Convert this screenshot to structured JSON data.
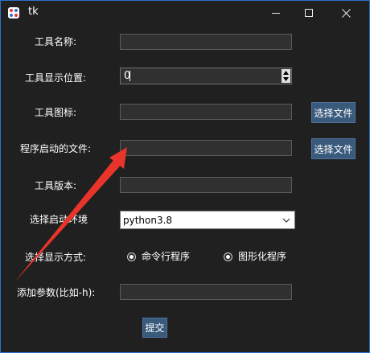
{
  "window": {
    "title": "tk"
  },
  "form": {
    "tool_name_label": "工具名称:",
    "display_position_label": "工具显示位置:",
    "display_position_value": "0",
    "icon_label": "工具图标:",
    "icon_button": "选择文件",
    "startup_file_label": "程序启动的文件:",
    "startup_file_button": "选择文件",
    "version_label": "工具版本:",
    "env_label": "选择启动环境",
    "env_value": "python3.8",
    "display_mode_label": "选择显示方式:",
    "mode_options": [
      "命令行程序",
      "图形化程序"
    ],
    "params_label": "添加参数(比如-h):",
    "submit_button": "提交"
  },
  "colors": {
    "background": "#202020",
    "button": "#3a5a7c",
    "window_border": "#2a72c9",
    "annotation_arrow": "#e8342a"
  }
}
